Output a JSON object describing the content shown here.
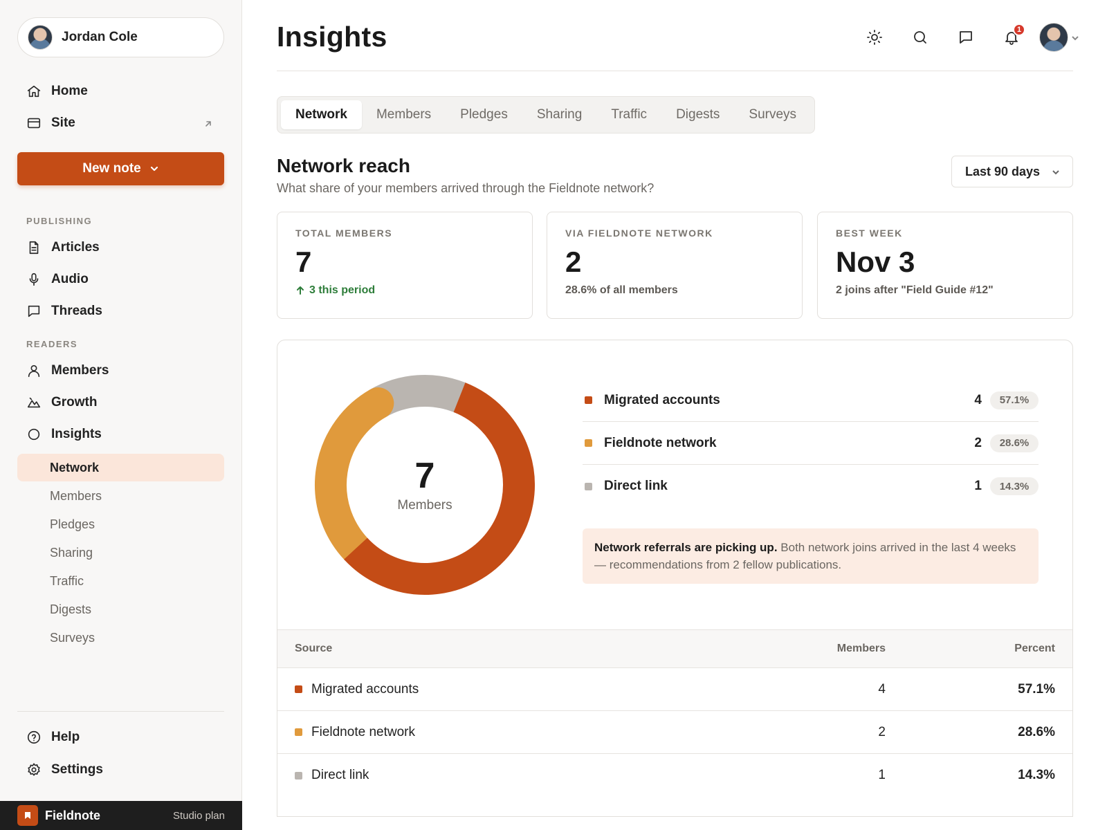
{
  "user": {
    "name": "Jordan Cole"
  },
  "nav": {
    "home": "Home",
    "site": "Site",
    "new_note": "New note",
    "publishing_label": "PUBLISHING",
    "articles": "Articles",
    "audio": "Audio",
    "threads": "Threads",
    "readers_label": "READERS",
    "members": "Members",
    "growth": "Growth",
    "insights": "Insights",
    "insights_sub": [
      "Network",
      "Members",
      "Pledges",
      "Sharing",
      "Traffic",
      "Digests",
      "Surveys"
    ],
    "help": "Help",
    "settings": "Settings"
  },
  "workspace": {
    "name": "Fieldnote",
    "plan": "Studio plan"
  },
  "header": {
    "title": "Insights",
    "notification_count": "1"
  },
  "tabs": [
    "Network",
    "Members",
    "Pledges",
    "Sharing",
    "Traffic",
    "Digests",
    "Surveys"
  ],
  "section": {
    "title": "Network reach",
    "subtitle": "What share of your members arrived through the Fieldnote network?",
    "range": "Last 90 days"
  },
  "stats": [
    {
      "label": "TOTAL MEMBERS",
      "value": "7",
      "note": "3 this period"
    },
    {
      "label": "VIA FIELDNOTE NETWORK",
      "value": "2",
      "note": "28.6% of all members"
    },
    {
      "label": "BEST WEEK",
      "value": "Nov 3",
      "note": "2 joins after \"Field Guide #12\""
    }
  ],
  "colors": {
    "accent": "#c44c16",
    "migrated": "#c44c16",
    "network": "#e09a3c",
    "direct": "#bab5b0"
  },
  "chart_data": {
    "type": "pie",
    "total": "7",
    "center_label": "Members",
    "series": [
      {
        "name": "Migrated accounts",
        "value": 4,
        "percent": "57.1%",
        "color": "#c44c16"
      },
      {
        "name": "Fieldnote network",
        "value": 2,
        "percent": "28.6%",
        "color": "#e09a3c"
      },
      {
        "name": "Direct link",
        "value": 1,
        "percent": "14.3%",
        "color": "#bab5b0"
      }
    ]
  },
  "callout": {
    "bold": "Network referrals are picking up.",
    "text": " Both network joins arrived in the last 4 weeks — recommendations from 2 fellow publications."
  },
  "table": {
    "headers": {
      "source": "Source",
      "members": "Members",
      "percent": "Percent"
    },
    "rows": [
      {
        "source": "Migrated accounts",
        "members": "4",
        "percent": "57.1%"
      },
      {
        "source": "Fieldnote network",
        "members": "2",
        "percent": "28.6%"
      },
      {
        "source": "Direct link",
        "members": "1",
        "percent": "14.3%"
      }
    ]
  }
}
